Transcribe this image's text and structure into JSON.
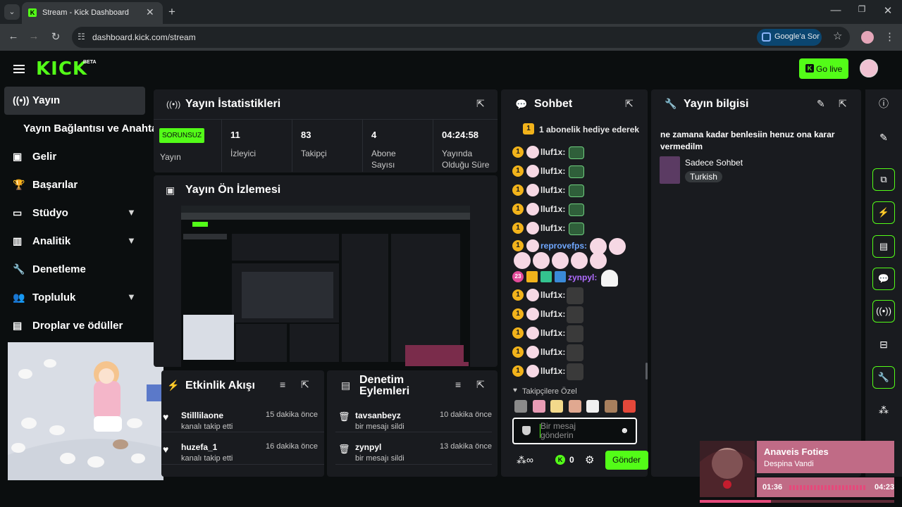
{
  "browser": {
    "tab_title": "Stream - Kick Dashboard",
    "url": "dashboard.kick.com/stream",
    "google_ask": "Google'a Sor"
  },
  "header": {
    "logo_text": "KICK",
    "beta": "BETA",
    "go_live": "Go live"
  },
  "sidebar": {
    "items": [
      {
        "label": "Yayın"
      },
      {
        "label": "Yayın Bağlantısı ve Anahtarı"
      },
      {
        "label": "Gelir"
      },
      {
        "label": "Başarılar"
      },
      {
        "label": "Stüdyo"
      },
      {
        "label": "Analitik"
      },
      {
        "label": "Denetleme"
      },
      {
        "label": "Topluluk"
      },
      {
        "label": "Droplar ve ödüller"
      }
    ]
  },
  "stats": {
    "title": "Yayın İstatistikleri",
    "status_badge": "SORUNSUZ",
    "status_label": "Yayın",
    "viewers_value": "11",
    "viewers_label": "İzleyici",
    "followers_value": "83",
    "followers_label": "Takipçi",
    "subs_value": "4",
    "subs_label": "Abone Sayısı",
    "uptime_value": "04:24:58",
    "uptime_label": "Yayında Olduğu Süre"
  },
  "preview": {
    "title": "Yayın Ön İzlemesi"
  },
  "activity": {
    "title": "Etkinlik Akışı",
    "rows": [
      {
        "name": "Stilllilaone",
        "action": "kanalı takip etti",
        "time": "15 dakika önce"
      },
      {
        "name": "huzefa_1",
        "action": "kanalı takip etti",
        "time": "16 dakika önce"
      }
    ]
  },
  "moderation": {
    "title": "Denetim Eylemleri",
    "rows": [
      {
        "name": "tavsanbeyz",
        "action": "bir mesajı sildi",
        "time": "10 dakika önce"
      },
      {
        "name": "zynpyl",
        "action": "bir mesajı sildi",
        "time": "13 dakika önce"
      }
    ]
  },
  "chat": {
    "title": "Sohbet",
    "gift_banner": "1 abonelik hediye ederek",
    "usernames": {
      "u1": "lluf1x:",
      "u2": "reprovefps:",
      "u3": "zynpyl:"
    },
    "sub_badge_number": "23",
    "followers_only": "Takipçilere Özel",
    "input_placeholder": "Bir mesaj gönderin",
    "kicks_count": "0",
    "send": "Gönder",
    "accent": "#53fc18"
  },
  "stream_info": {
    "title": "Yayın bilgisi",
    "stream_title": "ne zamana kadar benlesiin henuz ona karar vermedilm",
    "category": "Sadece Sohbet",
    "language": "Turkish"
  },
  "music": {
    "song": "Anaveis Foties",
    "artist": "Despina Vandi",
    "elapsed": "01:36",
    "total": "04:23",
    "progress": 0.365
  }
}
